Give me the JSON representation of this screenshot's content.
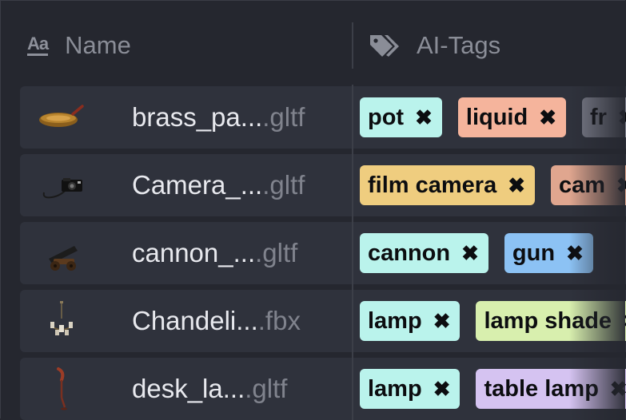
{
  "header": {
    "name_icon": "Aa",
    "name_label": "Name",
    "tags_icon": "tag-icon",
    "tags_label": "AI-Tags"
  },
  "rows": [
    {
      "thumb": "frying-pan",
      "base": "brass_pa...",
      "ext": ".gltf",
      "tags": [
        {
          "label": "pot",
          "color": "#baf3ec"
        },
        {
          "label": "liquid",
          "color": "#f5b49c"
        },
        {
          "label": "fr",
          "color": "#7d7f8c"
        }
      ]
    },
    {
      "thumb": "camera",
      "base": "Camera_...",
      "ext": ".gltf",
      "tags": [
        {
          "label": "film camera",
          "color": "#efcd7f"
        },
        {
          "label": "cam",
          "color": "#e0a68f"
        }
      ]
    },
    {
      "thumb": "cannon",
      "base": "cannon_...",
      "ext": ".gltf",
      "tags": [
        {
          "label": "cannon",
          "color": "#baf3ec"
        },
        {
          "label": "gun",
          "color": "#8cc2f4"
        }
      ]
    },
    {
      "thumb": "chandelier",
      "base": "Chandeli...",
      "ext": ".fbx",
      "tags": [
        {
          "label": "lamp",
          "color": "#baf3ec"
        },
        {
          "label": "lamp shade",
          "color": "#d8efae"
        }
      ]
    },
    {
      "thumb": "desk-lamp",
      "base": "desk_la...",
      "ext": ".gltf",
      "tags": [
        {
          "label": "lamp",
          "color": "#baf3ec"
        },
        {
          "label": "table lamp",
          "color": "#d5c3f1"
        }
      ]
    }
  ],
  "remove_glyph": "✖"
}
